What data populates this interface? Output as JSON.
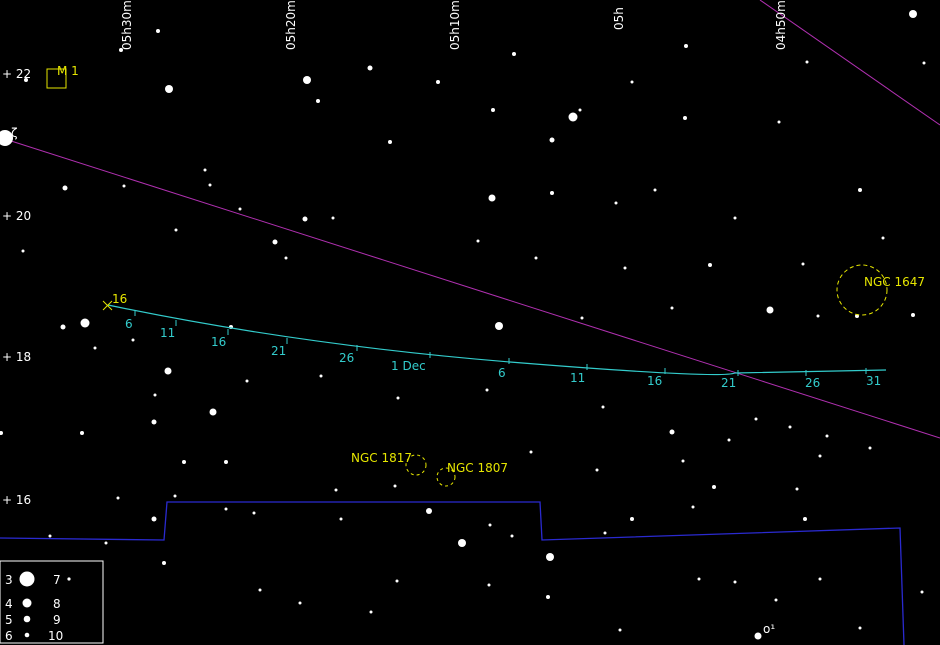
{
  "colors": {
    "background": "#000000",
    "grid_labels": "#ffffff",
    "objects": "#e6e600",
    "track": "#33cccc",
    "ecliptic": "#b030b0",
    "boundary": "#2a2ad0",
    "stars": "#ffffff"
  },
  "ra_labels": [
    "05h30m",
    "05h20m",
    "05h10m",
    "05h",
    "04h50m"
  ],
  "dec_labels": [
    "+ 22",
    "+ 20",
    "+ 18",
    "+ 16"
  ],
  "objects": [
    {
      "id": "m1",
      "label": "M 1",
      "shape": "square-icon"
    },
    {
      "id": "ngc1647",
      "label": "NGC 1647",
      "shape": "dashed-circle-icon"
    },
    {
      "id": "ngc1817",
      "label": "NGC 1817",
      "shape": "dashed-circle-icon"
    },
    {
      "id": "ngc1807",
      "label": "NGC 1807",
      "shape": "dashed-circle-icon"
    }
  ],
  "star_labels": [
    {
      "id": "zeta",
      "label": "ζ"
    },
    {
      "id": "omicron1",
      "label": "o¹"
    }
  ],
  "track": {
    "start_label": "16",
    "tick_labels": [
      "6",
      "11",
      "16",
      "21",
      "26",
      "1 Dec",
      "6",
      "11",
      "16",
      "21",
      "26",
      "31"
    ]
  },
  "legend": {
    "magnitudes": [
      "3",
      "4",
      "5",
      "6",
      "7",
      "8",
      "9",
      "10"
    ]
  }
}
